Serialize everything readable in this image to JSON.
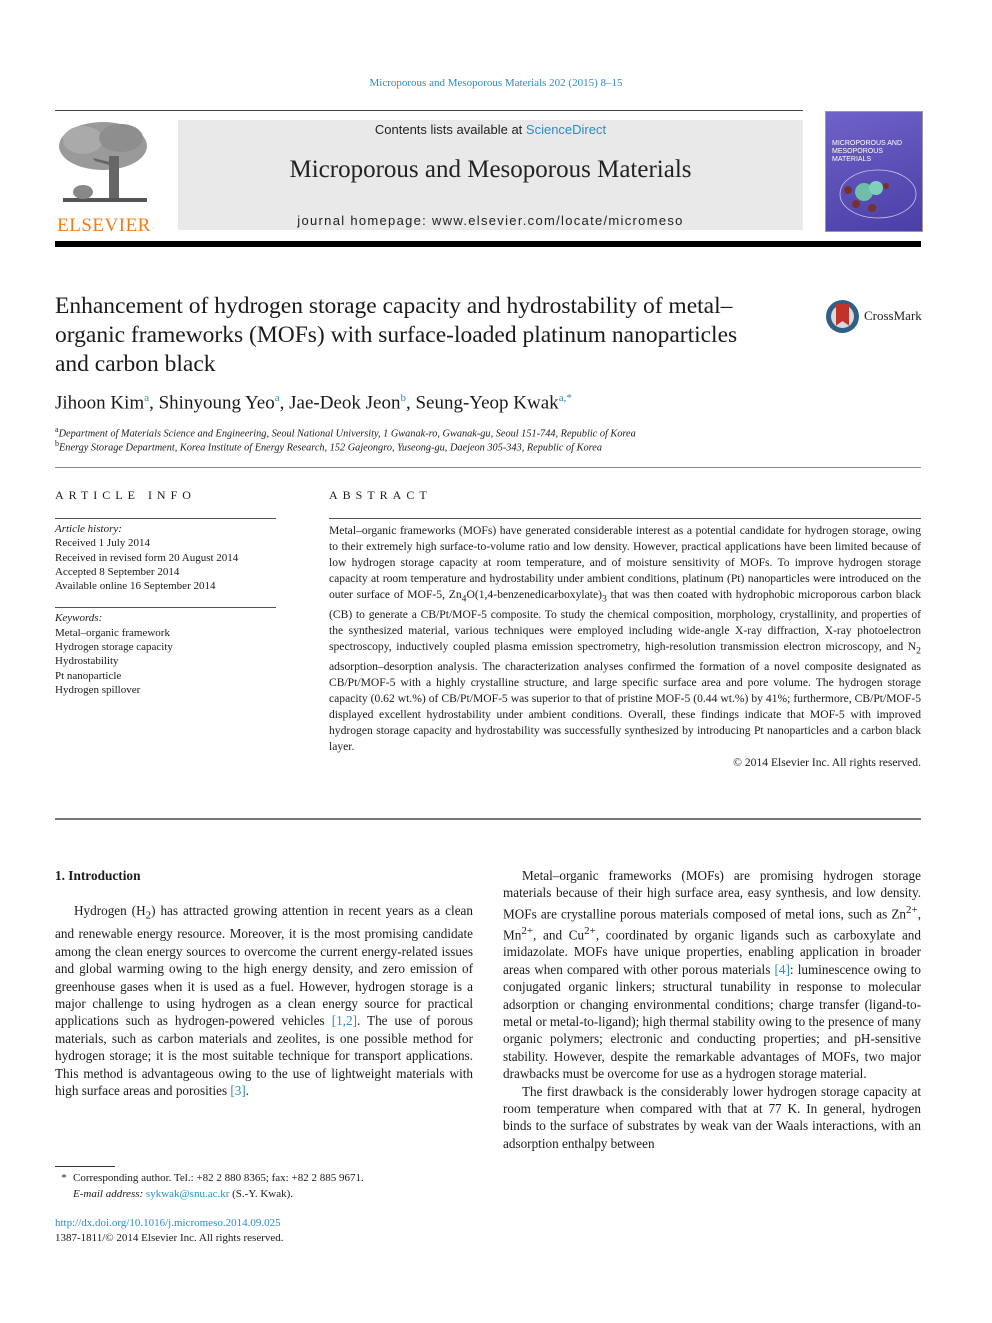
{
  "header": {
    "citation": "Microporous and Mesoporous Materials 202 (2015) 8–15",
    "contents_prefix": "Contents lists available at ",
    "contents_link": "ScienceDirect",
    "journal_name": "Microporous and Mesoporous Materials",
    "homepage": "journal homepage: www.elsevier.com/locate/micromeso",
    "publisher_logo_text": "ELSEVIER",
    "cover_title": "MICROPOROUS AND MESOPOROUS MATERIALS",
    "brand_orange": "#f07c1a",
    "link_blue": "#2b8cc4"
  },
  "article": {
    "title": "Enhancement of hydrogen storage capacity and hydrostability of metal–organic frameworks (MOFs) with surface-loaded platinum nanoparticles and carbon black",
    "crossmark_label": "CrossMark",
    "authors": [
      {
        "name": "Jihoon Kim",
        "aff": "a"
      },
      {
        "name": "Shinyoung Yeo",
        "aff": "a"
      },
      {
        "name": "Jae-Deok Jeon",
        "aff": "b"
      },
      {
        "name": "Seung-Yeop Kwak",
        "aff": "a,*"
      }
    ],
    "affiliations": [
      {
        "key": "a",
        "text": "Department of Materials Science and Engineering, Seoul National University, 1 Gwanak-ro, Gwanak-gu, Seoul 151-744, Republic of Korea"
      },
      {
        "key": "b",
        "text": "Energy Storage Department, Korea Institute of Energy Research, 152 Gajeongro, Yuseong-gu, Daejeon 305-343, Republic of Korea"
      }
    ]
  },
  "article_info": {
    "heading": "ARTICLE INFO",
    "history_label": "Article history:",
    "history": [
      "Received 1 July 2014",
      "Received in revised form 20 August 2014",
      "Accepted 8 September 2014",
      "Available online 16 September 2014"
    ],
    "keywords_label": "Keywords:",
    "keywords": [
      "Metal–organic framework",
      "Hydrogen storage capacity",
      "Hydrostability",
      "Pt nanoparticle",
      "Hydrogen spillover"
    ]
  },
  "abstract": {
    "heading": "ABSTRACT",
    "p1": "Metal–organic frameworks (MOFs) have generated considerable interest as a potential candidate for hydrogen storage, owing to their extremely high surface-to-volume ratio and low density. However, practical applications have been limited because of low hydrogen storage capacity at room temperature, and of moisture sensitivity of MOFs. To improve hydrogen storage capacity at room temperature and hydrostability under ambient conditions, platinum (Pt) nanoparticles were introduced on the outer surface of MOF-5, Zn",
    "sub1": "4",
    "p2": "O(1,4-benzenedicarboxylate)",
    "sub2": "3",
    "p3": " that was then coated with hydrophobic microporous carbon black (CB) to generate a CB/Pt/MOF-5 composite. To study the chemical composition, morphology, crystallinity, and properties of the synthesized material, various techniques were employed including wide-angle X-ray diffraction, X-ray photoelectron spectroscopy, inductively coupled plasma emission spectrometry, high-resolution transmission electron microscopy, and N",
    "sub3": "2",
    "p4": " adsorption–desorption analysis. The characterization analyses confirmed the formation of a novel composite designated as CB/Pt/MOF-5 with a highly crystalline structure, and large specific surface area and pore volume. The hydrogen storage capacity (0.62 wt.%) of CB/Pt/MOF-5 was superior to that of pristine MOF-5 (0.44 wt.%) by 41%; furthermore, CB/Pt/MOF-5 displayed excellent hydrostability under ambient conditions. Overall, these findings indicate that MOF-5 with improved hydrogen storage capacity and hydrostability was successfully synthesized by introducing Pt nanoparticles and a carbon black layer.",
    "copyright": "© 2014 Elsevier Inc. All rights reserved."
  },
  "body": {
    "section_heading": "1. Introduction",
    "left_p1_a": "Hydrogen (H",
    "left_p1_sub": "2",
    "left_p1_b": ") has attracted growing attention in recent years as a clean and renewable energy resource. Moreover, it is the most promising candidate among the clean energy sources to overcome the current energy-related issues and global warming owing to the high energy density, and zero emission of greenhouse gases when it is used as a fuel. However, hydrogen storage is a major challenge to using hydrogen as a clean energy source for practical applications such as hydrogen-powered vehicles ",
    "ref_1_2": "[1,2]",
    "left_p1_c": ". The use of porous materials, such as carbon materials and zeolites, is one possible method for hydrogen storage; it is the most suitable technique for transport applications. This method is advantageous owing to the use of lightweight materials with high surface areas and porosities ",
    "ref_3": "[3]",
    "left_p1_d": ".",
    "right_p1_a": "Metal–organic frameworks (MOFs) are promising hydrogen storage materials because of their high surface area, easy synthesis, and low density. MOFs are crystalline porous materials composed of metal ions, such as Zn",
    "sup_zn": "2+",
    "right_p1_b": ", Mn",
    "sup_mn": "2+",
    "right_p1_c": ", and Cu",
    "sup_cu": "2+",
    "right_p1_d": ", coordinated by organic ligands such as carboxylate and imidazolate. MOFs have unique properties, enabling application in broader areas when compared with other porous materials ",
    "ref_4": "[4]",
    "right_p1_e": ": luminescence owing to conjugated organic linkers; structural tunability in response to molecular adsorption or changing environmental conditions; charge transfer (ligand-to-metal or metal-to-ligand); high thermal stability owing to the presence of many organic polymers; electronic and conducting properties; and pH-sensitive stability. However, despite the remarkable advantages of MOFs, two major drawbacks must be overcome for use as a hydrogen storage material.",
    "right_p2": "The first drawback is the considerably lower hydrogen storage capacity at room temperature when compared with that at 77 K. In general, hydrogen binds to the surface of substrates by weak van der Waals interactions, with an adsorption enthalpy between"
  },
  "footnotes": {
    "corresponding": "Corresponding author. Tel.: +82 2 880 8365; fax: +82 2 885 9671.",
    "email_label": "E-mail address: ",
    "email": "sykwak@snu.ac.kr",
    "email_suffix": " (S.-Y. Kwak).",
    "doi": "http://dx.doi.org/10.1016/j.micromeso.2014.09.025",
    "issn": "1387-1811/© 2014 Elsevier Inc. All rights reserved."
  }
}
